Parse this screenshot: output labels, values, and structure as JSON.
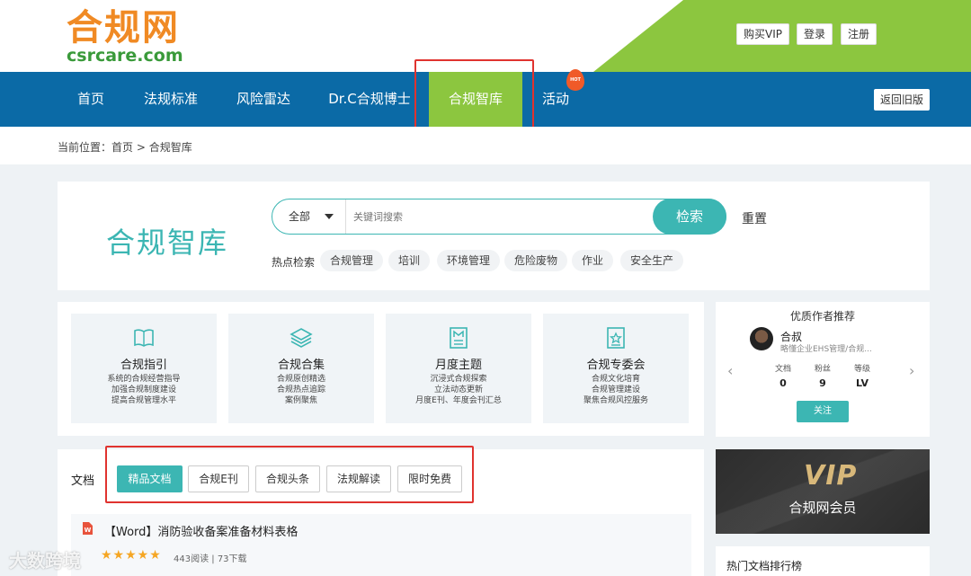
{
  "header": {
    "logo_cn": "合规网",
    "logo_en": "csrcare.com",
    "buttons": [
      "购买VIP",
      "登录",
      "注册"
    ]
  },
  "nav": {
    "items": [
      "首页",
      "法规标准",
      "风险雷达",
      "Dr.C合规博士",
      "合规智库",
      "活动"
    ],
    "active": "合规智库",
    "hot_badge": "HOT",
    "back_button": "返回旧版"
  },
  "breadcrumb": {
    "label": "当前位置：",
    "home": "首页",
    "sep": ">",
    "current": "合规智库"
  },
  "search": {
    "title": "合规智库",
    "category": "全部",
    "placeholder": "关键词搜索",
    "button": "检索",
    "reset": "重置",
    "hot_label": "热点检索",
    "hot_tags": [
      "合规管理",
      "培训",
      "环境管理",
      "危险废物",
      "作业",
      "安全生产"
    ]
  },
  "features": [
    {
      "title": "合规指引",
      "lines": [
        "系统的合规经营指导",
        "加强合规制度建设",
        "提高合规管理水平"
      ],
      "icon": "book-icon"
    },
    {
      "title": "合规合集",
      "lines": [
        "合规原创精选",
        "合规热点追踪",
        "案例聚焦"
      ],
      "icon": "layers-icon"
    },
    {
      "title": "月度主题",
      "lines": [
        "沉浸式合规探索",
        "立法动态更新",
        "月度E刊、年度会刊汇总"
      ],
      "icon": "document-m-icon"
    },
    {
      "title": "合规专委会",
      "lines": [
        "合规文化培育",
        "合规管理建设",
        "聚焦合规风控服务"
      ],
      "icon": "star-badge-icon"
    }
  ],
  "author": {
    "heading": "优质作者推荐",
    "name": "合叔",
    "desc": "略懂企业EHS管理/合规...",
    "stats": [
      {
        "label": "文档",
        "value": "0"
      },
      {
        "label": "粉丝",
        "value": "9"
      },
      {
        "label": "等级",
        "value": "LV"
      }
    ],
    "follow": "关注"
  },
  "docs": {
    "label": "文档",
    "tabs": [
      "精品文档",
      "合规E刊",
      "合规头条",
      "法规解读",
      "限时免费"
    ],
    "active_tab": "精品文档",
    "items": [
      {
        "title": "【Word】消防验收备案准备材料表格",
        "rating": 5,
        "meta": "443阅读 | 73下载"
      }
    ]
  },
  "vip": {
    "logo": "VIP",
    "text": "合规网会员"
  },
  "ranking": {
    "title": "热门文档排行榜"
  },
  "watermark": "大数跨境",
  "colors": {
    "accent": "#3cb6b3",
    "nav": "#0b6aa6",
    "green": "#8cc63f",
    "highlight": "#e0332f"
  }
}
